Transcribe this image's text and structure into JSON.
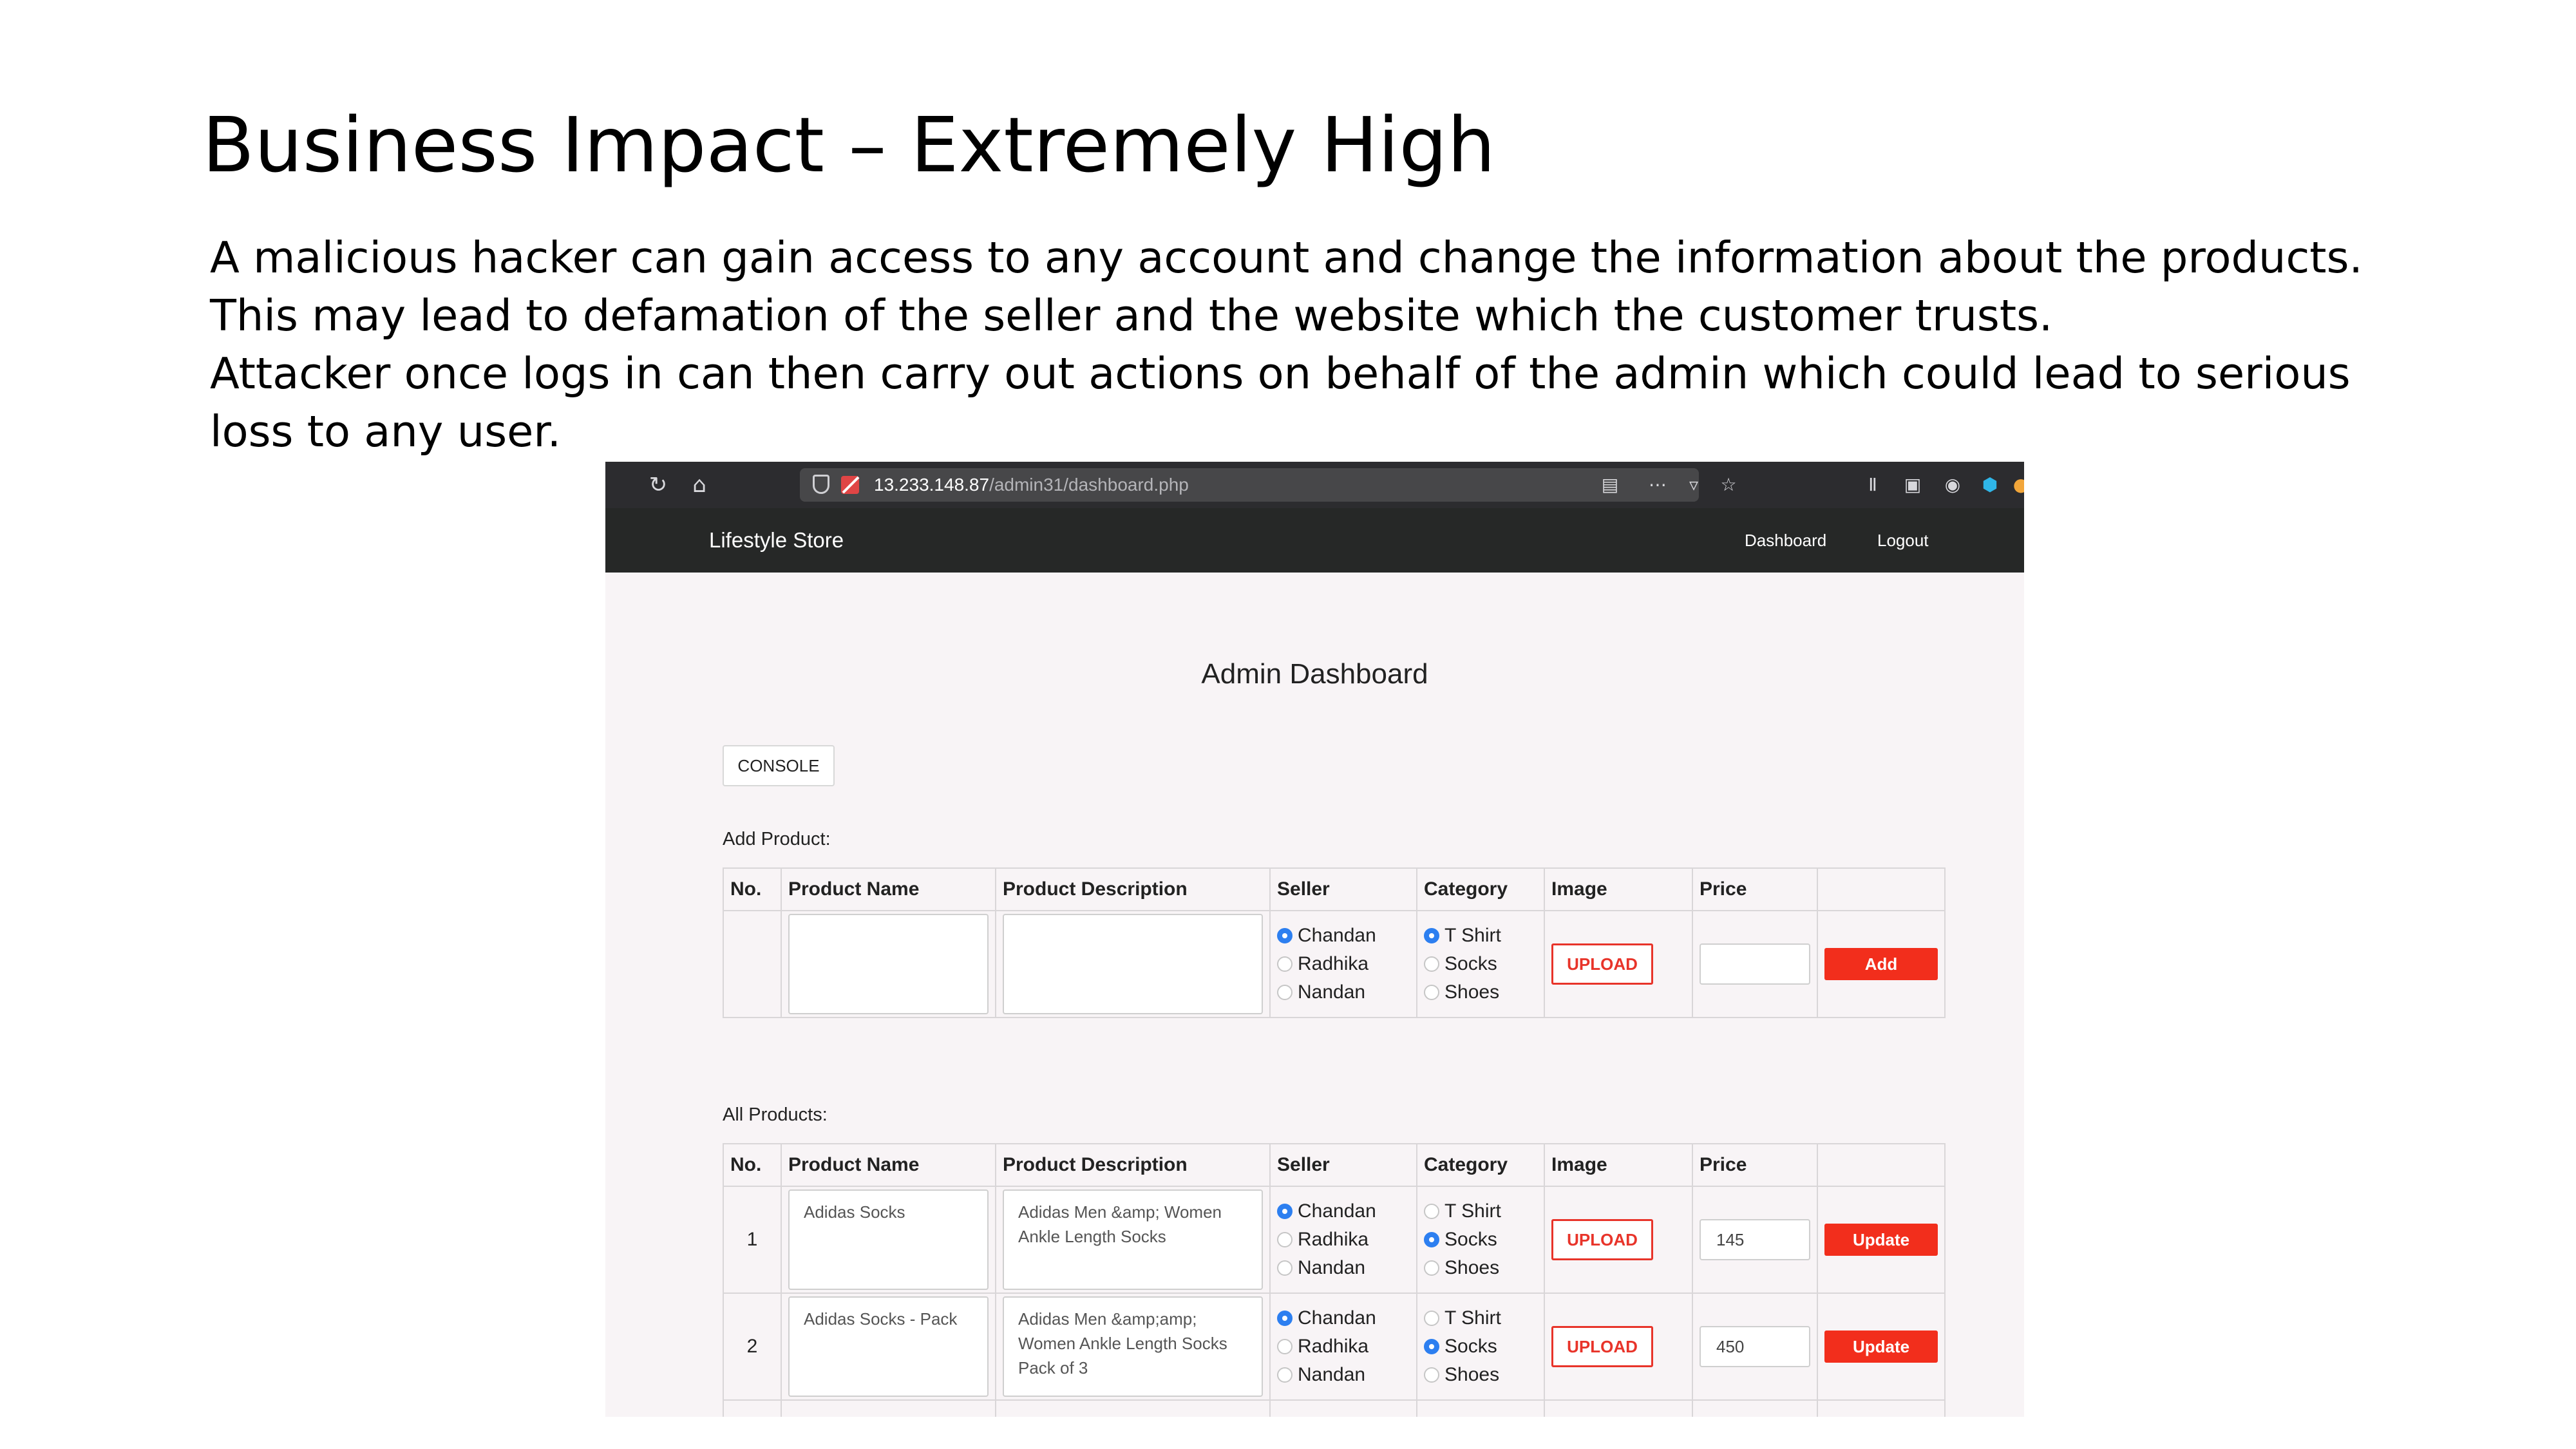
{
  "slide": {
    "title": "Business Impact – Extremely High",
    "paragraphs": [
      "A malicious hacker can gain access to any account and change the information about the products. This may lead to defamation of the seller and the website which the customer trusts.",
      "Attacker once logs in can then carry out actions on behalf of the admin which could lead to serious loss to any user."
    ]
  },
  "browser": {
    "url_host": "13.233.148.87",
    "url_path": "/admin31/dashboard.php",
    "icons": [
      "reload-icon",
      "home-icon",
      "shield-icon",
      "insecure-lock-icon",
      "reader-view-icon",
      "more-icon",
      "pocket-icon",
      "bookmark-star-icon",
      "library-icon",
      "sidebar-icon",
      "account-icon",
      "extension-icon",
      "extension-icon-2"
    ]
  },
  "navbar": {
    "brand": "Lifestyle Store",
    "links": [
      "Dashboard",
      "Logout"
    ]
  },
  "page": {
    "heading": "Admin Dashboard",
    "console_label": "CONSOLE",
    "add_label": "Add Product:",
    "all_label": "All Products:",
    "columns": [
      "No.",
      "Product Name",
      "Product Description",
      "Seller",
      "Category",
      "Image",
      "Price",
      ""
    ],
    "sellers": [
      "Chandan",
      "Radhika",
      "Nandan"
    ],
    "categories": [
      "T Shirt",
      "Socks",
      "Shoes"
    ],
    "upload_label": "UPLOAD",
    "add_button": "Add",
    "update_button": "Update",
    "new_row": {
      "name": "",
      "description": "",
      "seller": "Chandan",
      "category": "T Shirt",
      "price": ""
    },
    "products": [
      {
        "no": "1",
        "name": "Adidas Socks",
        "description": "Adidas Men &amp; Women Ankle Length Socks",
        "seller": "Chandan",
        "category": "Socks",
        "price": "145"
      },
      {
        "no": "2",
        "name": "Adidas Socks - Pack",
        "description": "Adidas Men &amp;amp; Women Ankle Length Socks Pack of 3",
        "seller": "Chandan",
        "category": "Socks",
        "price": "450"
      }
    ]
  },
  "colors": {
    "accent_red": "#f22e1c",
    "radio_blue": "#2d7ff0",
    "navbar_bg": "#262827",
    "page_bg": "#f8f4f6"
  }
}
